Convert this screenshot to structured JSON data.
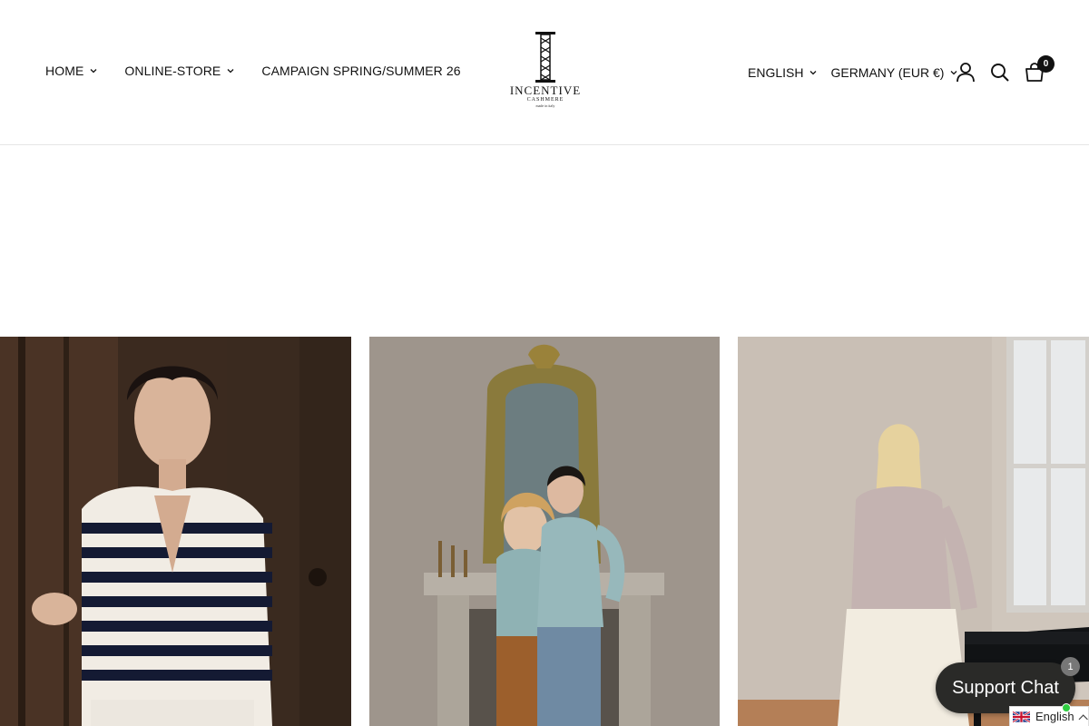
{
  "header": {
    "nav": [
      {
        "label": "HOME",
        "has_dropdown": true
      },
      {
        "label": "ONLINE-STORE",
        "has_dropdown": true
      },
      {
        "label": "CAMPAIGN SPRING/SUMMER 26",
        "has_dropdown": false
      }
    ],
    "logo": {
      "wordmark": "INCENTIVE",
      "sub": "CASHMERE",
      "tagline": "made in italy"
    },
    "language_selector": "ENGLISH",
    "country_selector": "GERMANY (EUR €)",
    "icons": [
      "account-icon",
      "search-icon",
      "cart-icon"
    ],
    "cart_count": "0"
  },
  "gallery": {
    "tiles": [
      {
        "name": "striped-cardigan-photo"
      },
      {
        "name": "couple-mirror-photo"
      },
      {
        "name": "piano-room-photo"
      }
    ]
  },
  "support_chat": {
    "label": "Support Chat",
    "badge": "1"
  },
  "translate_widget": {
    "language": "English"
  },
  "colors": {
    "text": "#111111",
    "divider": "#e6e6e6",
    "support_bg": "#2a2a28",
    "online": "#2ecc40"
  }
}
